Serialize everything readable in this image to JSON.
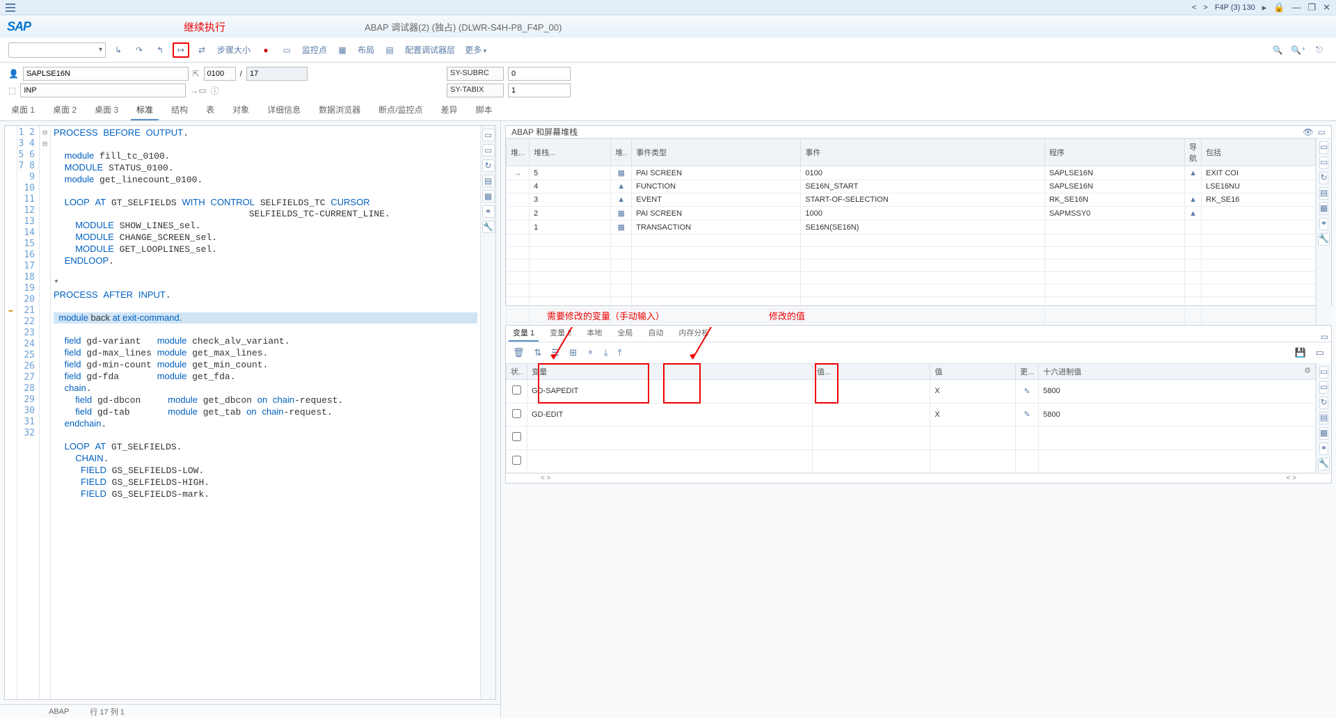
{
  "titlebar": {
    "system": "F4P (3) 130"
  },
  "header": {
    "anno": "继续执行",
    "title": "ABAP 调试器(2)  (独占) (DLWR-S4H-P8_F4P_00)"
  },
  "toolbar": {
    "step_label": "步骤大小",
    "watch_label": "监控点",
    "layout_label": "布局",
    "config_label": "配置调试器层",
    "more_label": "更多"
  },
  "fields": {
    "program": "SAPLSE16N",
    "line1": "0100",
    "line2": "17",
    "mode": "INP",
    "sy_subrc_lbl": "SY-SUBRC",
    "sy_subrc_val": "0",
    "sy_tabix_lbl": "SY-TABIX",
    "sy_tabix_val": "1"
  },
  "tabs": [
    "桌面 1",
    "桌面 2",
    "桌面 3",
    "标准",
    "结构",
    "表",
    "对象",
    "详细信息",
    "数据浏览器",
    "断点/监控点",
    "差异",
    "脚本"
  ],
  "active_tab": 3,
  "code_lines": [
    {
      "n": 1,
      "t": "PROCESS BEFORE OUTPUT.",
      "cls": [
        "kw",
        "kw",
        "kw"
      ],
      "blue": "PROCESS BEFORE OUTPUT"
    },
    {
      "n": 2,
      "t": ""
    },
    {
      "n": 3,
      "t": "  module fill_tc_0100."
    },
    {
      "n": 4,
      "t": "  MODULE STATUS_0100."
    },
    {
      "n": 5,
      "t": "  module get_linecount_0100."
    },
    {
      "n": 6,
      "t": ""
    },
    {
      "n": 7,
      "t": "  LOOP AT GT_SELFIELDS WITH CONTROL SELFIELDS_TC CURSOR",
      "fold": "⊟"
    },
    {
      "n": 8,
      "t": "                                    SELFIELDS_TC-CURRENT_LINE."
    },
    {
      "n": 9,
      "t": "    MODULE SHOW_LINES_sel."
    },
    {
      "n": 10,
      "t": "    MODULE CHANGE_SCREEN_sel."
    },
    {
      "n": 11,
      "t": "    MODULE GET_LOOPLINES_sel."
    },
    {
      "n": 12,
      "t": "  ENDLOOP."
    },
    {
      "n": 13,
      "t": ""
    },
    {
      "n": 14,
      "t": "*"
    },
    {
      "n": 15,
      "t": "PROCESS AFTER INPUT."
    },
    {
      "n": 16,
      "t": ""
    },
    {
      "n": 17,
      "t": "  module back at exit-command.",
      "cur": true,
      "arrow": true
    },
    {
      "n": 18,
      "t": ""
    },
    {
      "n": 19,
      "t": "  field gd-variant   module check_alv_variant."
    },
    {
      "n": 20,
      "t": "  field gd-max_lines module get_max_lines."
    },
    {
      "n": 21,
      "t": "  field gd-min-count module get_min_count."
    },
    {
      "n": 22,
      "t": "  field gd-fda       module get_fda."
    },
    {
      "n": 23,
      "t": "  chain."
    },
    {
      "n": 24,
      "t": "    field gd-dbcon     module get_dbcon on chain-request."
    },
    {
      "n": 25,
      "t": "    field gd-tab       module get_tab on chain-request."
    },
    {
      "n": 26,
      "t": "  endchain."
    },
    {
      "n": 27,
      "t": ""
    },
    {
      "n": 28,
      "t": "  LOOP AT GT_SELFIELDS.",
      "fold": "⊟"
    },
    {
      "n": 29,
      "t": "    CHAIN."
    },
    {
      "n": 30,
      "t": "     FIELD GS_SELFIELDS-LOW."
    },
    {
      "n": 31,
      "t": "     FIELD GS_SELFIELDS-HIGH."
    },
    {
      "n": 32,
      "t": "     FIELD GS_SELFIELDS-mark."
    }
  ],
  "status": {
    "mode": "ABAP",
    "pos": "行 17 列  1"
  },
  "stack": {
    "title": "ABAP 和屏幕堆栈",
    "headers": [
      "堆...",
      "堆栈...",
      "堆..",
      "事件类型",
      "事件",
      "程序",
      "导航",
      "包括"
    ],
    "rows": [
      {
        "ind": "→",
        "lvl": "5",
        "ic": "▦",
        "type": "PAI SCREEN",
        "evt": "0100",
        "prog": "SAPLSE16N",
        "nav": "▲",
        "inc": "EXIT COI"
      },
      {
        "ind": "",
        "lvl": "4",
        "ic": "▲",
        "type": "FUNCTION",
        "evt": "SE16N_START",
        "prog": "SAPLSE16N",
        "nav": "",
        "inc": "LSE16NU"
      },
      {
        "ind": "",
        "lvl": "3",
        "ic": "▲",
        "type": "EVENT",
        "evt": "START-OF-SELECTION",
        "prog": "RK_SE16N",
        "nav": "▲",
        "inc": "RK_SE16"
      },
      {
        "ind": "",
        "lvl": "2",
        "ic": "▦",
        "type": "PAI SCREEN",
        "evt": "1000",
        "prog": "SAPMSSY0",
        "nav": "▲",
        "inc": ""
      },
      {
        "ind": "",
        "lvl": "1",
        "ic": "▦",
        "type": "TRANSACTION",
        "evt": "SE16N(SE16N)",
        "prog": "",
        "nav": "",
        "inc": ""
      }
    ]
  },
  "var_anno": {
    "left": "需要修改的变量（手动输入）",
    "right": "修改的值"
  },
  "vartabs": [
    "变量 1",
    "变量 2",
    "本地",
    "全局",
    "自动",
    "内存分析"
  ],
  "vartabs_active": 0,
  "var_table": {
    "headers": [
      "状..",
      "变量",
      "值...",
      "值",
      "更...",
      "十六进制值"
    ],
    "rows": [
      {
        "name": "GD-SAPEDIT",
        "v1": "",
        "v2": "X",
        "hex": "5800"
      },
      {
        "name": "GD-EDIT",
        "v1": "",
        "v2": "X",
        "hex": "5800"
      },
      {
        "name": "",
        "v1": "",
        "v2": "",
        "hex": ""
      },
      {
        "name": "",
        "v1": "",
        "v2": "",
        "hex": ""
      }
    ]
  }
}
